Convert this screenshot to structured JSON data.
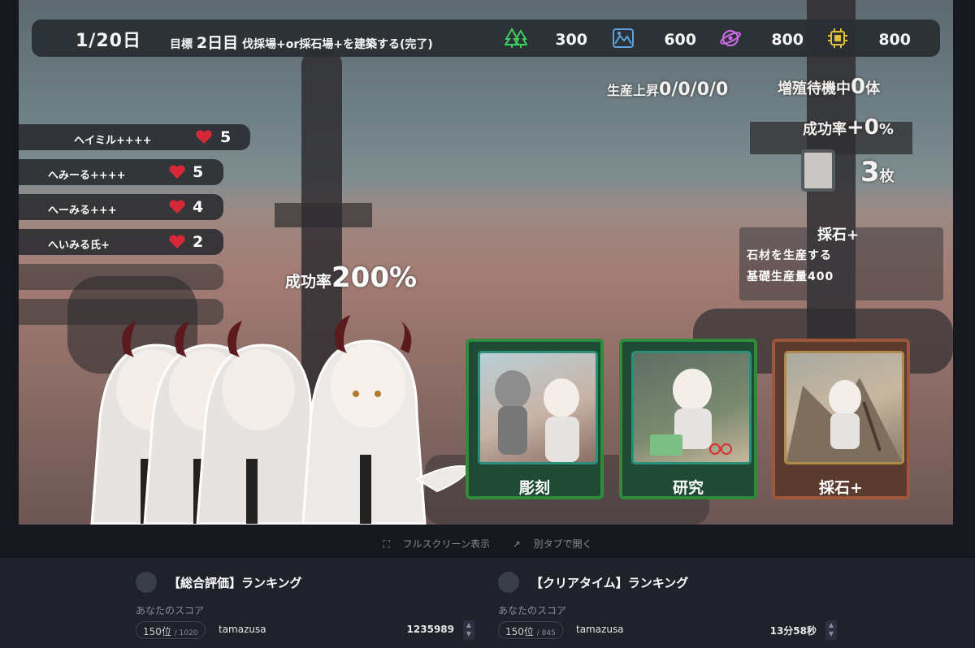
{
  "topbar": {
    "day": "1/20日",
    "goal_prefix": "目標",
    "goal_day": "2日目",
    "goal_text": "伐採場+or採石場+を建築する(完了)",
    "resources": [
      {
        "icon": "tree-icon",
        "value": "300",
        "color": "#3bd15f"
      },
      {
        "icon": "stone-icon",
        "value": "600",
        "color": "#5aa6e6"
      },
      {
        "icon": "research-icon",
        "value": "800",
        "color": "#d46bf0"
      },
      {
        "icon": "chip-icon",
        "value": "800",
        "color": "#e8c73a"
      }
    ]
  },
  "stats": {
    "production_label": "生産上昇",
    "production_value": "0/0/0/0",
    "breed_label": "増殖待機中",
    "breed_value": "0",
    "breed_unit": "体",
    "success_label": "成功率",
    "success_value": "+0",
    "success_unit": "%",
    "cards_value": "3",
    "cards_unit": "枚"
  },
  "info": {
    "title": "採石+",
    "line1": "石材を生産する",
    "line2": "基礎生産量400"
  },
  "units": [
    {
      "name": "ヘイミル++++",
      "hearts": "5"
    },
    {
      "name": "へみーる++++",
      "hearts": "5"
    },
    {
      "name": "へーみる+++",
      "hearts": "4"
    },
    {
      "name": "へいみる氏+",
      "hearts": "2"
    },
    {
      "name": "",
      "hearts": ""
    },
    {
      "name": "",
      "hearts": ""
    }
  ],
  "rate": {
    "label": "成功率",
    "value": "200%"
  },
  "cards": [
    {
      "label": "彫刻",
      "border": "#2f8a3a"
    },
    {
      "label": "研究",
      "border": "#2f8a3a"
    },
    {
      "label": "採石+",
      "border": "#a0563a"
    }
  ],
  "below": {
    "fullscreen": "フルスクリーン表示",
    "newtab": "別タブで開く"
  },
  "rankings": [
    {
      "title": "【総合評価】ランキング",
      "sub": "あなたのスコア",
      "rank": "150位",
      "total": "/ 1020",
      "user": "tamazusa",
      "score": "1235989"
    },
    {
      "title": "【クリアタイム】ランキング",
      "sub": "あなたのスコア",
      "rank": "150位",
      "total": "/ 845",
      "user": "tamazusa",
      "score": "13分58秒"
    }
  ]
}
